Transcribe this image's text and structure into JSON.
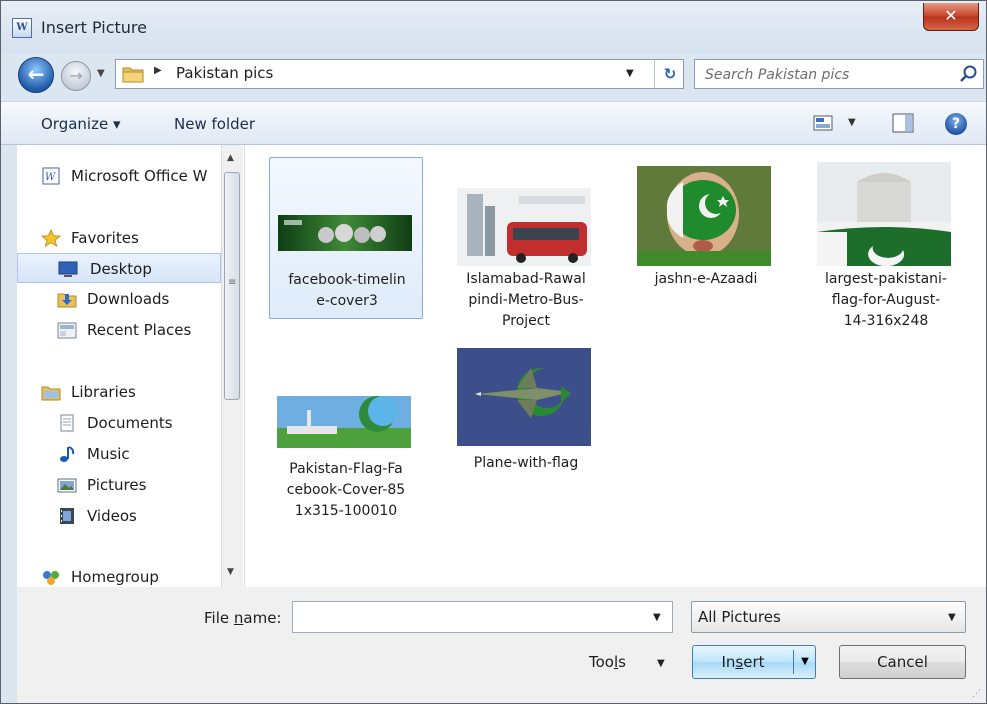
{
  "window": {
    "title": "Insert Picture",
    "app_icon": "W"
  },
  "nav": {
    "back_icon": "arrow-left",
    "forward_icon": "arrow-right",
    "address": "Pakistan pics",
    "search_placeholder": "Search Pakistan pics"
  },
  "toolbar": {
    "organize": "Organize ▾",
    "new_folder": "New folder"
  },
  "sidebar": {
    "items": [
      {
        "label": "Microsoft Office W",
        "icon": "word-icon"
      },
      {
        "label": "Favorites",
        "icon": "star-icon"
      },
      {
        "label": "Desktop",
        "icon": "desktop-icon"
      },
      {
        "label": "Downloads",
        "icon": "downloads-icon"
      },
      {
        "label": "Recent Places",
        "icon": "recent-places-icon"
      },
      {
        "label": "Libraries",
        "icon": "libraries-icon"
      },
      {
        "label": "Documents",
        "icon": "document-icon"
      },
      {
        "label": "Music",
        "icon": "music-icon"
      },
      {
        "label": "Pictures",
        "icon": "pictures-icon"
      },
      {
        "label": "Videos",
        "icon": "videos-icon"
      },
      {
        "label": "Homegroup",
        "icon": "homegroup-icon"
      }
    ],
    "selected": "Desktop"
  },
  "files": [
    {
      "caption_1": "facebook-timelin",
      "caption_2": "e-cover3",
      "caption_3": ""
    },
    {
      "caption_1": "Islamabad-Rawal",
      "caption_2": "pindi-Metro-Bus-",
      "caption_3": "Project"
    },
    {
      "caption_1": "jashn-e-Azaadi",
      "caption_2": "",
      "caption_3": ""
    },
    {
      "caption_1": "largest-pakistani-",
      "caption_2": "flag-for-August-",
      "caption_3": "14-316x248"
    },
    {
      "caption_1": "Pakistan-Flag-Fa",
      "caption_2": "cebook-Cover-85",
      "caption_3": "1x315-100010"
    },
    {
      "caption_1": "Plane-with-flag",
      "caption_2": "",
      "caption_3": ""
    }
  ],
  "bottom": {
    "file_name_label_pre": "File ",
    "file_name_label_u": "n",
    "file_name_label_post": "ame:",
    "file_name_value": "",
    "filter": "All Pictures",
    "tools_pre": "Too",
    "tools_u": "l",
    "tools_post": "s",
    "insert_pre": "In",
    "insert_u": "s",
    "insert_post": "ert",
    "cancel": "Cancel"
  },
  "colors": {
    "accent": "#3c7fb1",
    "selection": "#d6e5f8",
    "pakistan_green": "#1f7a2e"
  }
}
